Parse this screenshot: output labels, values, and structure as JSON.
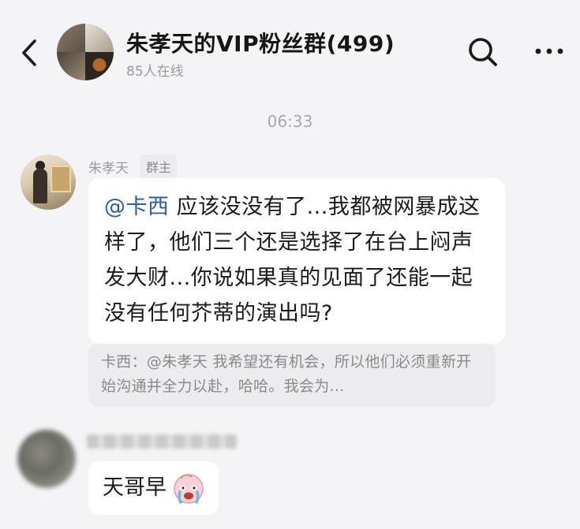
{
  "header": {
    "back_icon": "chevron-left-icon",
    "title": "朱孝天的VIP粉丝群(499)",
    "subtitle": "85人在线",
    "search_icon": "search-icon",
    "more_icon": "more-horizontal-icon"
  },
  "chat": {
    "timestamp": "06:33",
    "messages": [
      {
        "sender": "朱孝天",
        "role": "群主",
        "mention": "@卡西",
        "text": " 应该没没有了...我都被网暴成这样了，他们三个还是选择了在台上闷声发大财...你说如果真的见面了还能一起没有任何芥蒂的演出吗?",
        "quote": "卡西：@朱孝天 我希望还有机会，所以他们必须重新开始沟通并全力以赴，哈哈。我会为..."
      },
      {
        "sender_blurred": true,
        "text": "天哥早",
        "emoji": "crying-face-emoji"
      }
    ]
  },
  "colors": {
    "background": "#f4f4f6",
    "bubble": "#ffffff",
    "mention": "#2f5ea8",
    "quote_bg": "#ececee",
    "muted_text": "#9a9a9a"
  }
}
